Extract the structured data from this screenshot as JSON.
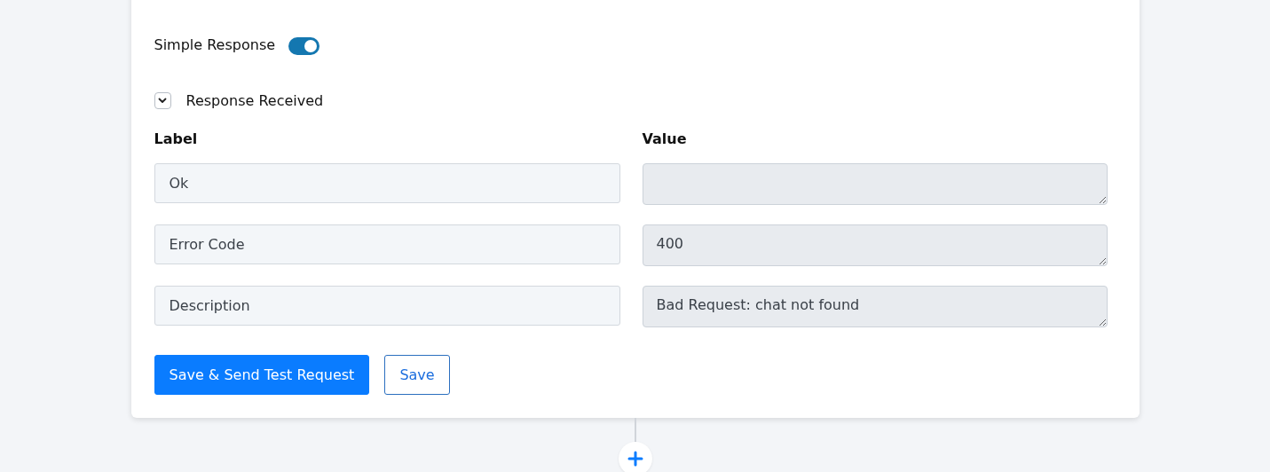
{
  "simple_response": {
    "label": "Simple Response",
    "on": true
  },
  "response_received": {
    "label": "Response Received",
    "expanded": true
  },
  "columns": [
    "Label",
    "Value"
  ],
  "rows": [
    {
      "label": "Ok"
    },
    {
      "label": "Error Code",
      "value": "400"
    },
    {
      "label": "Description",
      "value": "Bad Request: chat not found"
    }
  ],
  "buttons": [
    {
      "label": "Save & Send Test Request",
      "kind": "primary"
    },
    {
      "label": "Save",
      "kind": "outline"
    }
  ]
}
